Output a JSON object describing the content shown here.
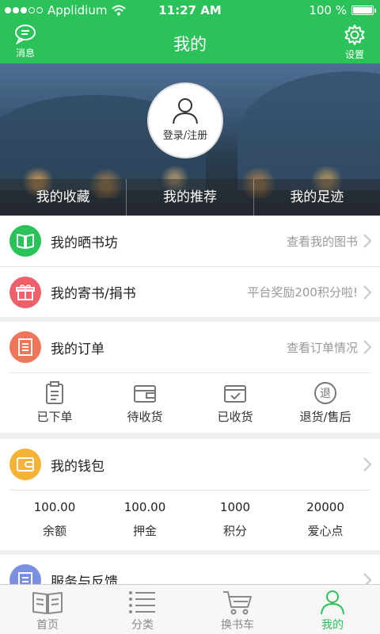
{
  "status_bar": {
    "carrier": "Applidium",
    "time": "11:27 AM",
    "battery": "100 %"
  },
  "nav": {
    "left_label": "消息",
    "title": "我的",
    "right_label": "设置"
  },
  "profile": {
    "login_label": "登录/注册"
  },
  "banner_tabs": [
    "我的收藏",
    "我的推荐",
    "我的足迹"
  ],
  "rows": {
    "bookshop": {
      "label": "我的晒书坊",
      "hint": "查看我的图书",
      "icon": "book-icon",
      "color": "#2cc25a"
    },
    "send": {
      "label": "我的寄书/捐书",
      "hint": "平台奖励200积分啦!",
      "icon": "gift-icon",
      "color": "#f0606a"
    },
    "orders": {
      "label": "我的订单",
      "hint": "查看订单情况",
      "icon": "order-list-icon",
      "color": "#f0765a"
    },
    "wallet": {
      "label": "我的钱包",
      "icon": "wallet-icon",
      "color": "#f5b335"
    },
    "service": {
      "label": "服务与反馈",
      "icon": "service-icon",
      "color": "#7b8fe0"
    }
  },
  "order_states": [
    "已下单",
    "待收货",
    "已收货",
    "退货/售后"
  ],
  "return_glyph": "退",
  "wallet_items": [
    {
      "value": "100.00",
      "label": "余额"
    },
    {
      "value": "100.00",
      "label": "押金"
    },
    {
      "value": "1000",
      "label": "积分"
    },
    {
      "value": "20000",
      "label": "爱心点"
    }
  ],
  "tabbar": [
    {
      "label": "首页",
      "icon": "book-open-icon"
    },
    {
      "label": "分类",
      "icon": "list-icon"
    },
    {
      "label": "换书车",
      "icon": "cart-icon"
    },
    {
      "label": "我的",
      "icon": "person-icon",
      "active": true
    }
  ],
  "colors": {
    "brand": "#2cc25a",
    "hint": "#999999"
  }
}
